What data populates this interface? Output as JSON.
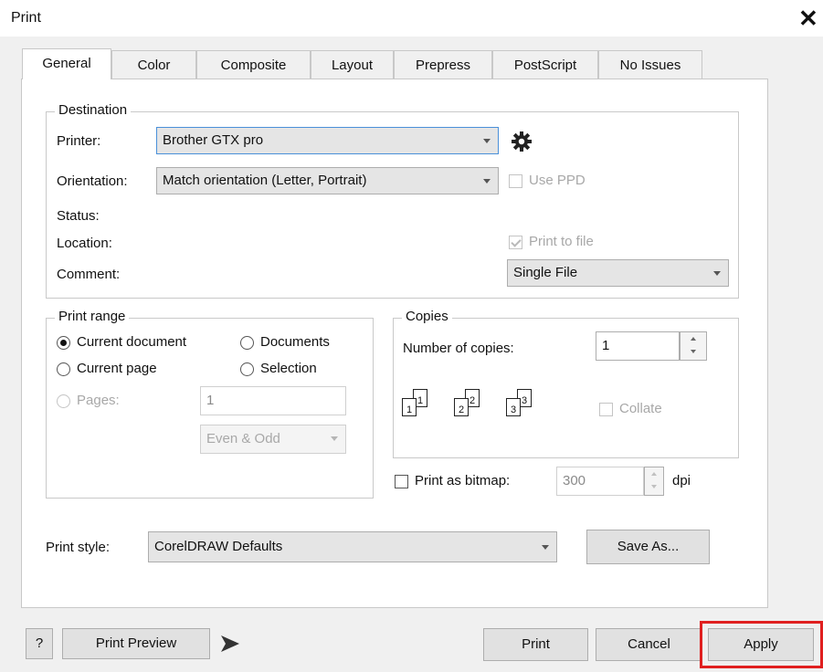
{
  "window": {
    "title": "Print",
    "close_glyph": "✕"
  },
  "tabs": [
    "General",
    "Color",
    "Composite",
    "Layout",
    "Prepress",
    "PostScript",
    "No Issues"
  ],
  "destination": {
    "legend": "Destination",
    "printer_label": "Printer:",
    "printer_value": "Brother GTX pro",
    "orientation_label": "Orientation:",
    "orientation_value": "Match orientation (Letter, Portrait)",
    "use_ppd_label": "Use PPD",
    "status_label": "Status:",
    "location_label": "Location:",
    "comment_label": "Comment:",
    "print_to_file_label": "Print to file",
    "print_to_file_checked": true,
    "file_mode_value": "Single File"
  },
  "print_range": {
    "legend": "Print range",
    "current_document": "Current document",
    "documents": "Documents",
    "current_page": "Current page",
    "selection": "Selection",
    "pages": "Pages:",
    "pages_value": "1",
    "even_odd": "Even & Odd",
    "selected": "current_document"
  },
  "copies": {
    "legend": "Copies",
    "number_label": "Number of copies:",
    "number_value": "1",
    "collate_label": "Collate",
    "page_icons": [
      "1",
      "1",
      "2",
      "2",
      "3",
      "3"
    ]
  },
  "bitmap": {
    "label": "Print as bitmap:",
    "dpi_value": "300",
    "dpi_unit": "dpi"
  },
  "print_style": {
    "label": "Print style:",
    "value": "CorelDRAW Defaults",
    "save_as": "Save As..."
  },
  "footer": {
    "help": "?",
    "print_preview": "Print Preview",
    "print": "Print",
    "cancel": "Cancel",
    "apply": "Apply"
  },
  "icons": {
    "gear": "gear-icon",
    "expand": "expand-arrow-icon"
  },
  "colors": {
    "highlight": "#e02020",
    "focus_border": "#4a90d9"
  }
}
